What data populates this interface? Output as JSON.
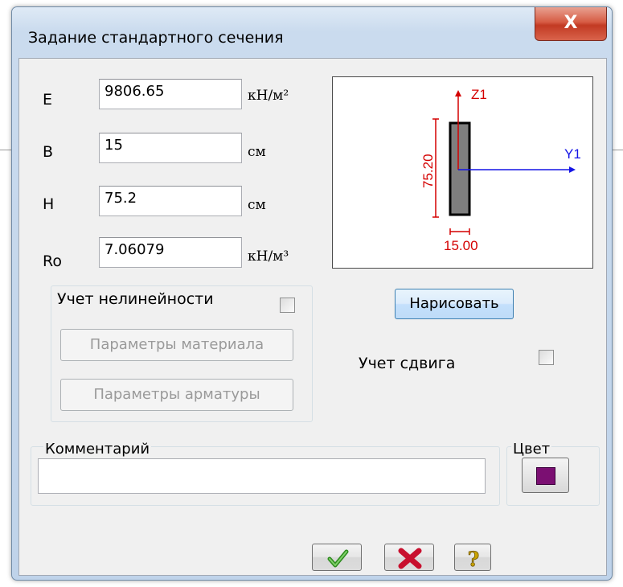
{
  "window": {
    "title": "Задание стандартного сечения",
    "close_glyph": "X"
  },
  "params": [
    {
      "label": "E",
      "value": "9806.65",
      "unit": "кН/м²"
    },
    {
      "label": "B",
      "value": "15",
      "unit": "см"
    },
    {
      "label": "H",
      "value": "75.2",
      "unit": "см"
    },
    {
      "label": "Ro",
      "value": "7.06079",
      "unit": "кН/м³"
    }
  ],
  "preview": {
    "z_axis_label": "Z1",
    "y_axis_label": "Y1",
    "height_dim": "75.20",
    "width_dim": "15.00",
    "colors": {
      "dimension": "#d40000",
      "y_axis": "#1414e6",
      "section_fill": "#7f7f7f"
    }
  },
  "draw_button": "Нарисовать",
  "nonlinearity": {
    "label": "Учет нелинейности",
    "checked": false,
    "material_button": "Параметры материала",
    "reinforcement_button": "Параметры арматуры"
  },
  "shear": {
    "label": "Учет сдвига",
    "checked": false
  },
  "comment": {
    "caption": "Комментарий",
    "value": ""
  },
  "color": {
    "caption": "Цвет",
    "swatch": "#7b0f72"
  },
  "footer": {
    "ok_icon": "checkmark-icon",
    "cancel_icon": "red-x-icon",
    "help_icon": "question-icon",
    "help_glyph": "?"
  }
}
